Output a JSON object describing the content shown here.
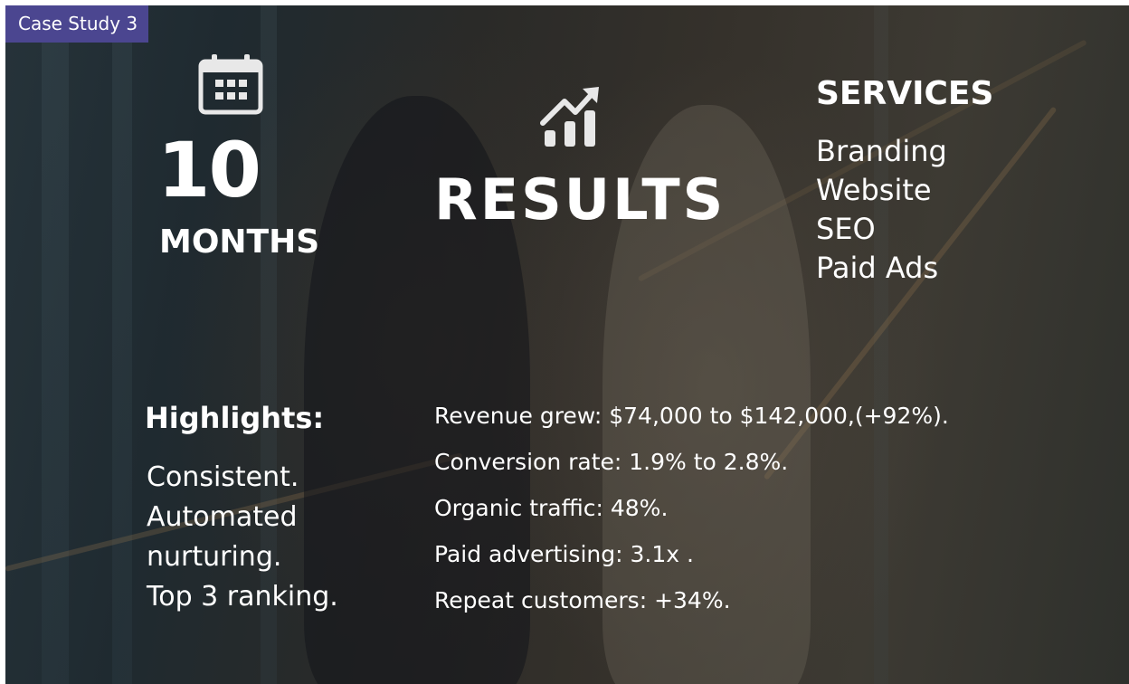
{
  "badge": {
    "label": "Case Study 3"
  },
  "icons": {
    "calendar": "calendar-icon",
    "growth_chart": "growth-chart-icon"
  },
  "duration": {
    "number": "10",
    "unit": "MONTHS"
  },
  "results": {
    "title": "RESULTS"
  },
  "services": {
    "heading": "SERVICES",
    "items": [
      "Branding",
      "Website",
      "SEO",
      "Paid Ads"
    ]
  },
  "highlights": {
    "heading": "Highlights:",
    "lines": [
      "Consistent.",
      "Automated",
      "nurturing.",
      "Top 3 ranking."
    ]
  },
  "metrics": [
    "Revenue grew: $74,000 to $142,000,(+92%).",
    "Conversion rate: 1.9% to 2.8%.",
    "Organic traffic: 48%.",
    "Paid advertising: 3.1x .",
    "Repeat customers: +34%."
  ],
  "colors": {
    "badge_background": "#4b4690",
    "text": "#ffffff",
    "icon": "#e8e8e8"
  }
}
